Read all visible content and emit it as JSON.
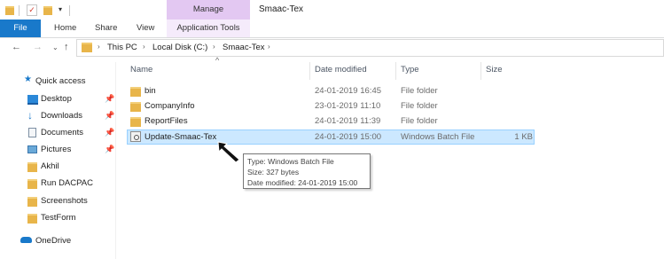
{
  "title_bar": {
    "title": "Smaac-Tex",
    "context_tab": "Manage"
  },
  "ribbon": {
    "tabs": [
      "File",
      "Home",
      "Share",
      "View",
      "Application Tools"
    ]
  },
  "address_bar": {
    "crumbs": [
      "This PC",
      "Local Disk (C:)",
      "Smaac-Tex"
    ]
  },
  "columns": {
    "name": "Name",
    "date_modified": "Date modified",
    "type": "Type",
    "size": "Size"
  },
  "navigation": {
    "items": [
      {
        "label": "Quick access",
        "icon": "star-icon",
        "pinned": false
      },
      {
        "label": "Desktop",
        "icon": "desktop-icon",
        "pinned": true
      },
      {
        "label": "Downloads",
        "icon": "download-icon",
        "pinned": true
      },
      {
        "label": "Documents",
        "icon": "documents-icon",
        "pinned": true
      },
      {
        "label": "Pictures",
        "icon": "pictures-icon",
        "pinned": true
      },
      {
        "label": "Akhil",
        "icon": "folder-icon",
        "pinned": false
      },
      {
        "label": "Run DACPAC",
        "icon": "folder-icon",
        "pinned": false
      },
      {
        "label": "Screenshots",
        "icon": "folder-icon",
        "pinned": false
      },
      {
        "label": "TestForm",
        "icon": "folder-icon",
        "pinned": false
      },
      {
        "label": "OneDrive",
        "icon": "cloud-icon",
        "pinned": false
      }
    ]
  },
  "files": [
    {
      "name": "bin",
      "date": "24-01-2019 16:45",
      "type": "File folder",
      "size": "",
      "selected": false
    },
    {
      "name": "CompanyInfo",
      "date": "23-01-2019 11:10",
      "type": "File folder",
      "size": "",
      "selected": false
    },
    {
      "name": "ReportFiles",
      "date": "24-01-2019 11:39",
      "type": "File folder",
      "size": "",
      "selected": false
    },
    {
      "name": "Update-Smaac-Tex",
      "date": "24-01-2019 15:00",
      "type": "Windows Batch File",
      "size": "1 KB",
      "selected": true
    }
  ],
  "tooltip": {
    "type_line": "Type: Windows Batch File",
    "size_line": "Size: 327 bytes",
    "date_line": "Date modified: 24-01-2019 15:00"
  },
  "colors": {
    "file_tab": "#1979ca",
    "context_tab": "#e3c8f2",
    "selection": "#cce8ff",
    "folder": "#e8b54a"
  }
}
